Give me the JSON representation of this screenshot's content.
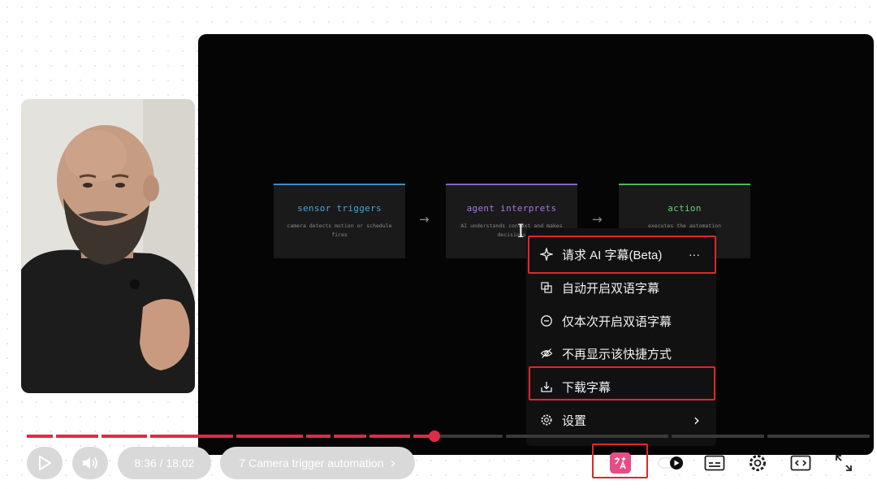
{
  "slide": {
    "boxes": [
      {
        "title": "sensor triggers",
        "desc": "camera detects motion or schedule fires",
        "color": "#4aa3df"
      },
      {
        "title": "agent interprets",
        "desc": "AI understands context and makes decisions",
        "color": "#a675e6"
      },
      {
        "title": "action",
        "desc": "executes the automation",
        "color": "#5fd46a"
      }
    ],
    "arrow": "→"
  },
  "player": {
    "time": "8:36 / 18:02",
    "chapter": "7 Camera trigger automation",
    "chapter_chevron": "›",
    "progress_fraction": 0.484
  },
  "menu": {
    "items": [
      {
        "label": "请求 AI 字幕(Beta)",
        "icon": "sparkle-icon",
        "extra": "···"
      },
      {
        "label": "自动开启双语字幕",
        "icon": "bilingual-icon"
      },
      {
        "label": "仅本次开启双语字幕",
        "icon": "minus-circle-icon"
      },
      {
        "label": "不再显示该快捷方式",
        "icon": "eye-off-icon"
      },
      {
        "label": "下载字幕",
        "icon": "download-icon"
      },
      {
        "label": "设置",
        "icon": "gear-icon",
        "extra": "›"
      }
    ]
  },
  "colors": {
    "accent": "#e12a48",
    "highlight": "#e0262b",
    "translate_button": "#e84c86"
  }
}
